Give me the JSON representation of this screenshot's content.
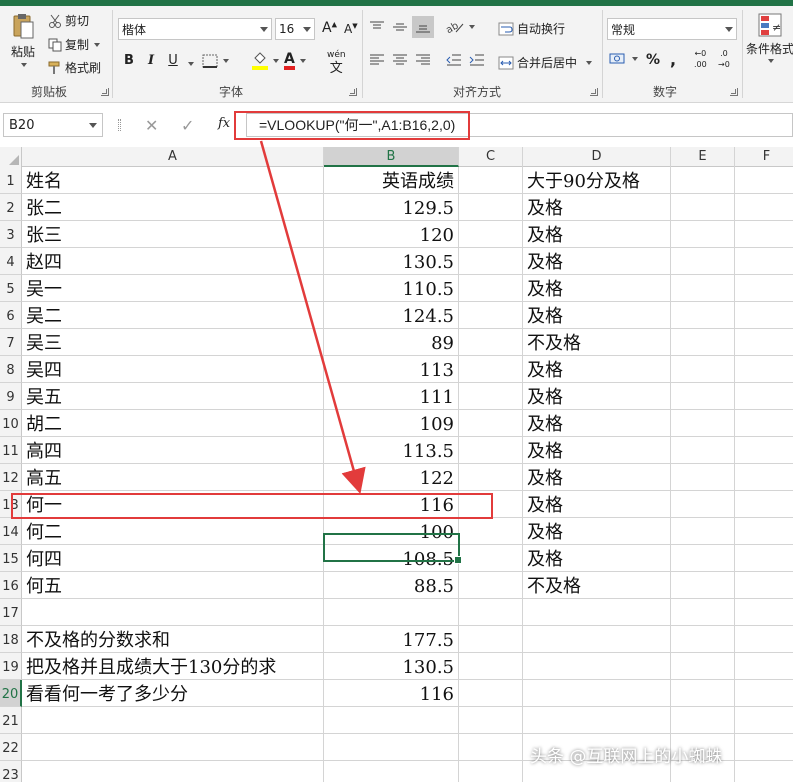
{
  "ribbon": {
    "clipboard": {
      "paste": "粘贴",
      "cut": "剪切",
      "copy": "复制",
      "format_painter": "格式刷",
      "group_label": "剪贴板"
    },
    "font": {
      "font_name": "楷体",
      "font_size": "16",
      "bold": "B",
      "italic": "I",
      "underline": "U",
      "font_color": "A",
      "phonetic": "wén",
      "group_label": "字体"
    },
    "alignment": {
      "wrap_text": "自动换行",
      "merge_center": "合并后居中",
      "group_label": "对齐方式"
    },
    "number": {
      "format": "常规",
      "percent": "%",
      "comma": ",",
      "inc_decimal": ".00",
      "dec_decimal": ".0",
      "group_label": "数字"
    },
    "styles": {
      "conditional": "条件格式"
    }
  },
  "formula_bar": {
    "name_box": "B20",
    "fx": "fx",
    "formula": "=VLOOKUP(\"何一\",A1:B16,2,0)"
  },
  "columns": [
    "A",
    "B",
    "C",
    "D",
    "E",
    "F"
  ],
  "rows": [
    {
      "n": "1",
      "a": "姓名",
      "b": "英语成绩",
      "d": "大于90分及格"
    },
    {
      "n": "2",
      "a": "张二",
      "b": "129.5",
      "d": "及格"
    },
    {
      "n": "3",
      "a": "张三",
      "b": "120",
      "d": "及格"
    },
    {
      "n": "4",
      "a": "赵四",
      "b": "130.5",
      "d": "及格"
    },
    {
      "n": "5",
      "a": "吴一",
      "b": "110.5",
      "d": "及格"
    },
    {
      "n": "6",
      "a": "吴二",
      "b": "124.5",
      "d": "及格"
    },
    {
      "n": "7",
      "a": "吴三",
      "b": "89",
      "d": "不及格"
    },
    {
      "n": "8",
      "a": "吴四",
      "b": "113",
      "d": "及格"
    },
    {
      "n": "9",
      "a": "吴五",
      "b": "111",
      "d": "及格"
    },
    {
      "n": "10",
      "a": "胡二",
      "b": "109",
      "d": "及格"
    },
    {
      "n": "11",
      "a": "高四",
      "b": "113.5",
      "d": "及格"
    },
    {
      "n": "12",
      "a": "高五",
      "b": "122",
      "d": "及格"
    },
    {
      "n": "13",
      "a": "何一",
      "b": "116",
      "d": "及格"
    },
    {
      "n": "14",
      "a": "何二",
      "b": "100",
      "d": "及格"
    },
    {
      "n": "15",
      "a": "何四",
      "b": "108.5",
      "d": "及格"
    },
    {
      "n": "16",
      "a": "何五",
      "b": "88.5",
      "d": "不及格"
    },
    {
      "n": "17",
      "a": "",
      "b": "",
      "d": ""
    },
    {
      "n": "18",
      "a": "不及格的分数求和",
      "b": "177.5",
      "d": ""
    },
    {
      "n": "19",
      "a": "把及格并且成绩大于130分的求",
      "b": "130.5",
      "d": ""
    },
    {
      "n": "20",
      "a": "看看何一考了多少分",
      "b": "116",
      "d": ""
    },
    {
      "n": "21",
      "a": "",
      "b": "",
      "d": ""
    },
    {
      "n": "22",
      "a": "",
      "b": "",
      "d": ""
    },
    {
      "n": "23",
      "a": "",
      "b": "",
      "d": ""
    }
  ],
  "active_cell": "B20",
  "watermark": "头条 @互联网上的小蜘蛛",
  "colors": {
    "excel_green": "#217346",
    "annotation_red": "#e23b3b",
    "ribbon_bg": "#f3f3f3"
  }
}
